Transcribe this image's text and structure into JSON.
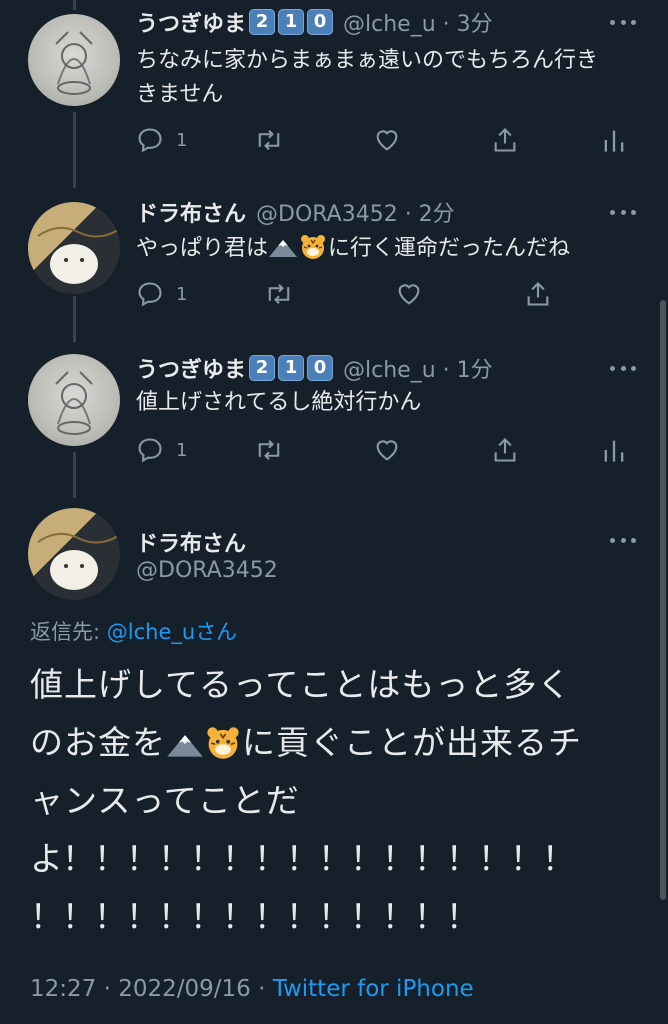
{
  "colors": {
    "background": "#15202b",
    "text": "#e7e9ea",
    "muted": "#8b98a5",
    "link": "#1d9bf0",
    "line": "#38444d"
  },
  "tweets": [
    {
      "name": "うつぎゆま",
      "badges": [
        "2",
        "1",
        "0"
      ],
      "handle_time": "@lche_u · 3分",
      "text_lines": [
        "ちなみに家からまぁまぁ遠いのでもちろん行き",
        "きません"
      ],
      "reply_count": "1"
    },
    {
      "name": "ドラ布さん",
      "handle_time": "@DORA3452 · 2分",
      "text_before": "やっぱり君は",
      "text_after": "に行く運命だったんだね",
      "reply_count": "1"
    },
    {
      "name": "うつぎゆま",
      "badges": [
        "2",
        "1",
        "0"
      ],
      "handle_time": "@lche_u · 1分",
      "text": "値上げされてるし絶対行かん",
      "reply_count": "1"
    }
  ],
  "main": {
    "name": "ドラ布さん",
    "handle": "@DORA3452",
    "reply_prefix": "返信先: ",
    "reply_handle": "@lche_u",
    "reply_suffix": "さん",
    "line1": "値上げしてるってことはもっと多く",
    "line2_before": "のお金を",
    "line2_after": "に貢ぐことが出来るチ",
    "line3": "ャンスってことだ",
    "line4": "よ！！！！！！！！！！！！！！！！",
    "line5": "！！！！！！！！！！！！！！",
    "time_date": "12:27 · 2022/09/16 · ",
    "source": "Twitter for iPhone"
  },
  "icons": [
    "reply-icon",
    "retweet-icon",
    "like-icon",
    "share-icon",
    "analytics-icon",
    "more-icon",
    "mountain-emoji-icon",
    "tiger-emoji-icon"
  ]
}
